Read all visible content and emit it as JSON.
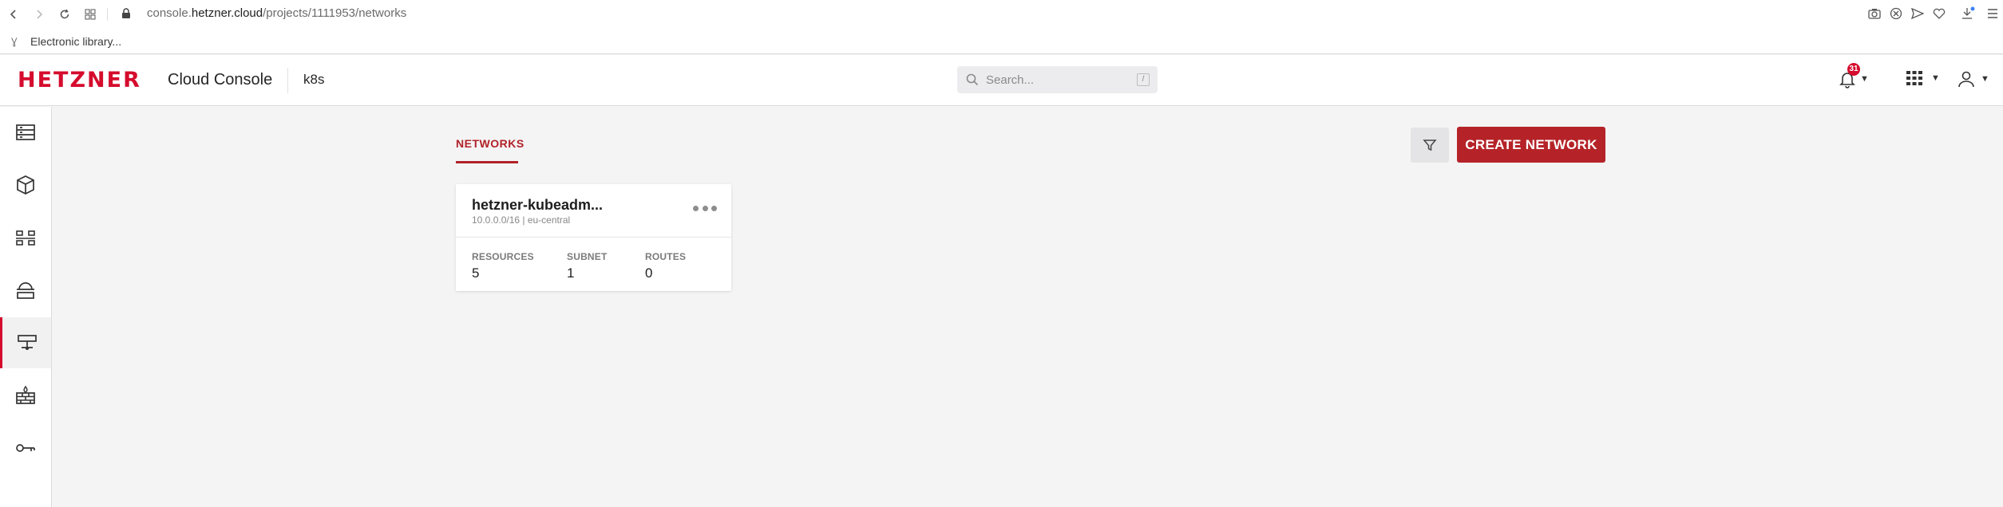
{
  "browser": {
    "url_prefix": "console.",
    "url_domain": "hetzner.cloud",
    "url_path": "/projects/1111953/networks",
    "bookmark_label": "Electronic library..."
  },
  "header": {
    "logo_text": "HETZNER",
    "console_title": "Cloud Console",
    "project_name": "k8s",
    "search_placeholder": "Search...",
    "search_shortcut": "/",
    "notification_count": "31"
  },
  "page": {
    "tab_label": "NETWORKS",
    "create_button_label": "CREATE NETWORK"
  },
  "networks": [
    {
      "name": "hetzner-kubeadm...",
      "subtitle": "10.0.0.0/16 | eu-central",
      "stats": [
        {
          "label": "RESOURCES",
          "value": "5"
        },
        {
          "label": "SUBNET",
          "value": "1"
        },
        {
          "label": "ROUTES",
          "value": "0"
        }
      ]
    }
  ],
  "sidebar": {
    "items": [
      "servers-icon",
      "volumes-icon",
      "load-balancers-icon",
      "floating-ips-icon",
      "networks-icon",
      "firewalls-icon",
      "security-keys-icon"
    ],
    "active": "networks-icon"
  },
  "colors": {
    "brand": "#d50c2d",
    "accent": "#b52328"
  }
}
